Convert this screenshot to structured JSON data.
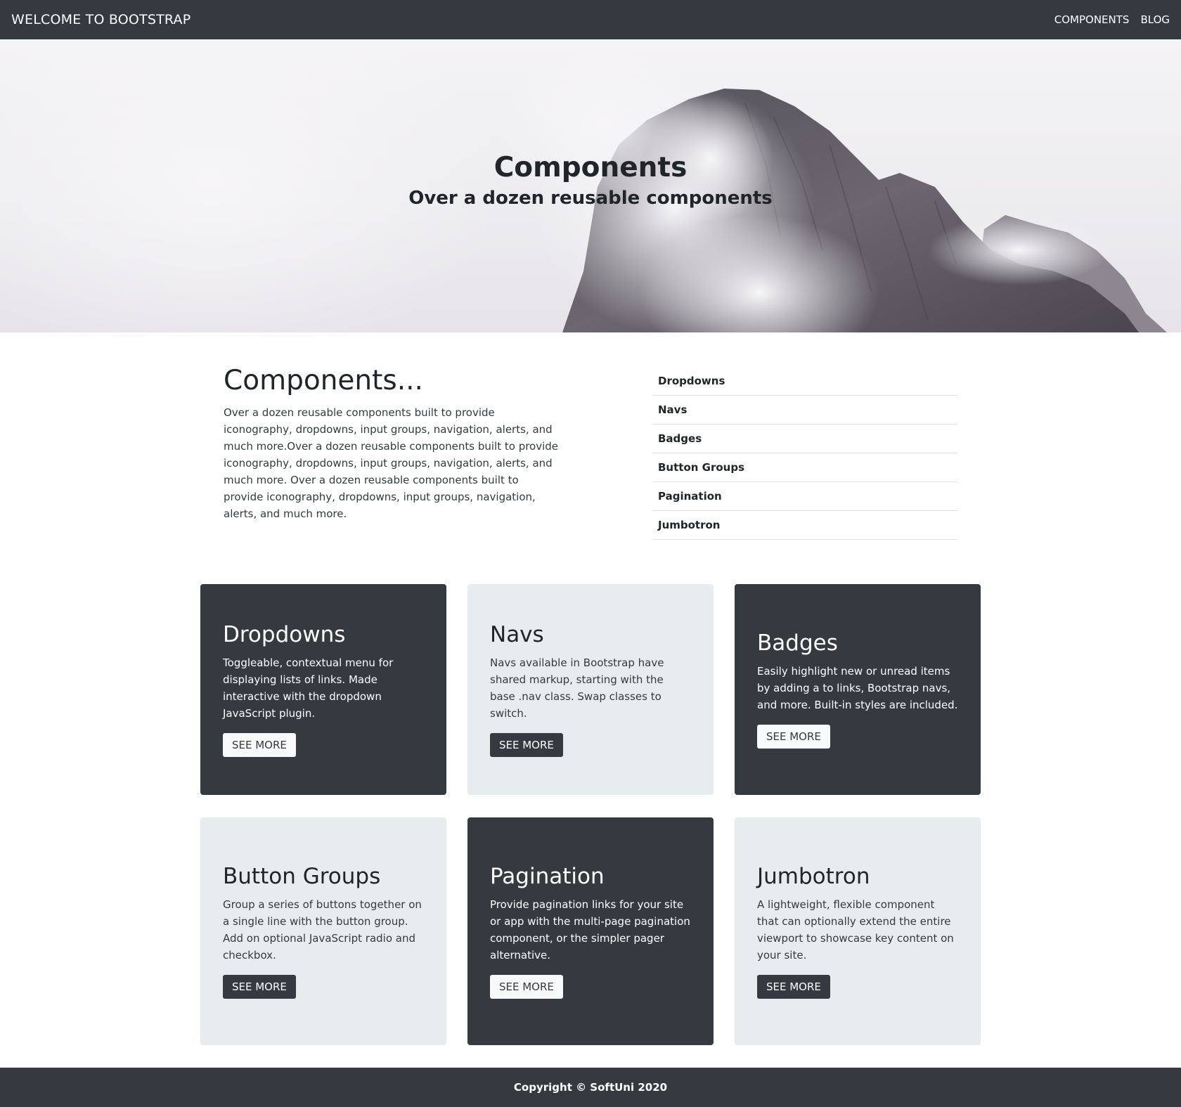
{
  "navbar": {
    "brand": "WELCOME TO BOOTSTRAP",
    "links": [
      "COMPONENTS",
      "BLOG"
    ]
  },
  "hero": {
    "title": "Components",
    "subtitle": "Over a dozen reusable components"
  },
  "intro": {
    "title": "Components...",
    "text": "Over a dozen reusable components built to provide iconography, dropdowns, input groups, navigation, alerts, and much more.Over a dozen reusable components built to provide iconography, dropdowns, input groups, navigation, alerts, and much more. Over a dozen reusable components built to provide iconography, dropdowns, input groups, navigation, alerts, and much more."
  },
  "toc": [
    "Dropdowns",
    "Navs",
    "Badges",
    "Button Groups",
    "Pagination",
    "Jumbotron"
  ],
  "cards": [
    {
      "title": "Dropdowns",
      "text": "Toggleable, contextual menu for displaying lists of links. Made interactive with the dropdown JavaScript plugin.",
      "button": "SEE MORE"
    },
    {
      "title": "Navs",
      "text": "Navs available in Bootstrap have shared markup, starting with the base .nav class. Swap classes to switch.",
      "button": "SEE MORE"
    },
    {
      "title": "Badges",
      "text": "Easily highlight new or unread items by adding a to links, Bootstrap navs, and more. Built-in styles are included.",
      "button": "SEE MORE"
    },
    {
      "title": "Button Groups",
      "text": "Group a series of buttons together on a single line with the button group. Add on optional JavaScript radio and checkbox.",
      "button": "SEE MORE"
    },
    {
      "title": "Pagination",
      "text": "Provide pagination links for your site or app with the multi-page pagination component, or the simpler pager alternative.",
      "button": "SEE MORE"
    },
    {
      "title": "Jumbotron",
      "text": "A lightweight, flexible component that can optionally extend the entire viewport to showcase key content on your site.",
      "button": "SEE MORE"
    }
  ],
  "footer": {
    "text": "Copyright © SoftUni 2020"
  },
  "colors": {
    "dark": "#343a40",
    "light": "#e9ecef",
    "text": "#212529"
  }
}
